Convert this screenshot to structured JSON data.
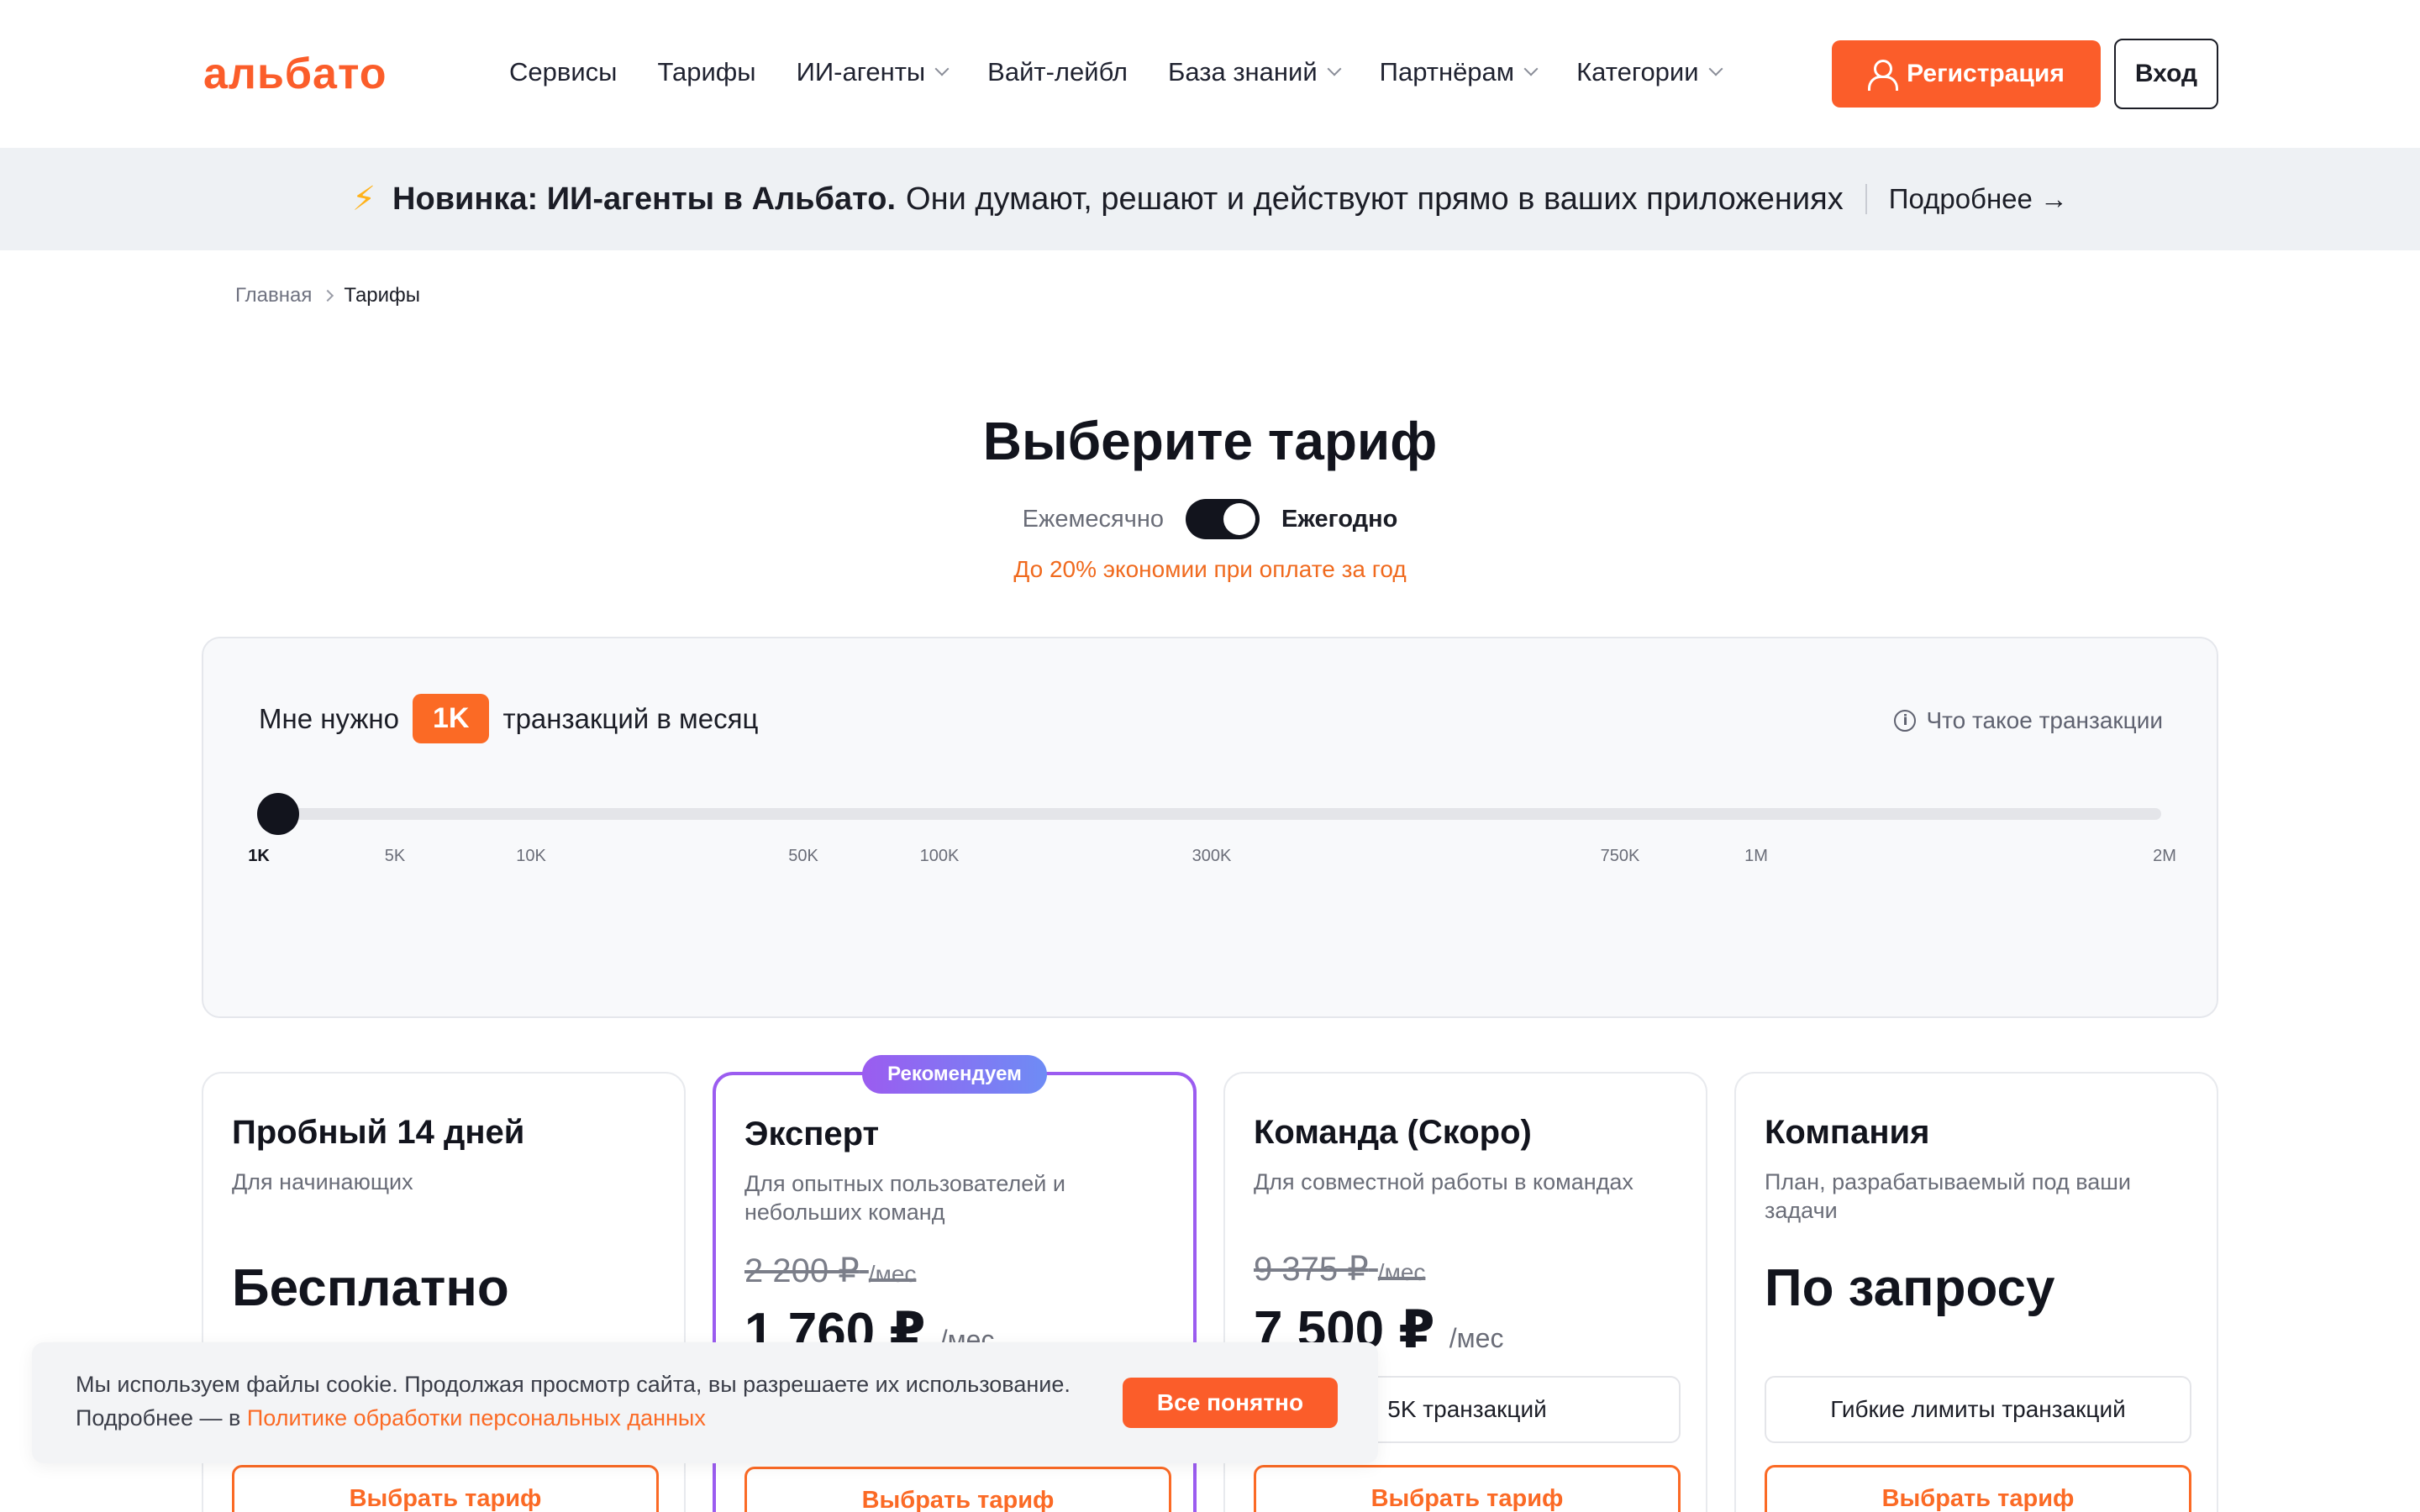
{
  "header": {
    "logo": "альбато",
    "nav": [
      {
        "label": "Сервисы",
        "dropdown": false
      },
      {
        "label": "Тарифы",
        "dropdown": false
      },
      {
        "label": "ИИ-агенты",
        "dropdown": true
      },
      {
        "label": "Вайт-лейбл",
        "dropdown": false
      },
      {
        "label": "База знаний",
        "dropdown": true
      },
      {
        "label": "Партнёрам",
        "dropdown": true
      },
      {
        "label": "Категории",
        "dropdown": true
      }
    ],
    "register_label": "Регистрация",
    "login_label": "Вход"
  },
  "banner": {
    "bold": "Новинка: ИИ-агенты в Альбато.",
    "text": "Они думают, решают и действуют прямо в ваших приложениях",
    "link": "Подробнее →"
  },
  "breadcrumb": {
    "home": "Главная",
    "current": "Тарифы"
  },
  "pricing": {
    "title": "Выберите тариф",
    "toggle_left": "Ежемесячно",
    "toggle_right": "Ежегодно",
    "toggle_on": true,
    "savings": "До 20% экономии при оплате за год"
  },
  "slider": {
    "prefix": "Мне нужно",
    "value": "1K",
    "suffix": "транзакций в месяц",
    "help": "Что такое транзакции",
    "ticks": [
      "1K",
      "5K",
      "10K",
      "50K",
      "100K",
      "300K",
      "750K",
      "1M",
      "2M"
    ]
  },
  "cards": [
    {
      "title": "Пробный 14 дней",
      "subtitle": "Для начинающих",
      "price": "Бесплатно",
      "button": "Выбрать тариф"
    },
    {
      "badge": "Рекомендуем",
      "title": "Эксперт",
      "subtitle": "Для опытных пользователей и небольших команд",
      "old_price": "2 200 ₽",
      "old_per": "/мес",
      "price": "1 760 ₽",
      "per": "/мес",
      "button": "Выбрать тариф"
    },
    {
      "title": "Команда (Скоро)",
      "subtitle": "Для совместной работы в командах",
      "old_price": "9 375 ₽",
      "old_per": "/мес",
      "price": "7 500 ₽",
      "per": "/мес",
      "pill": "5K транзакций",
      "button": "Выбрать тариф"
    },
    {
      "title": "Компания",
      "subtitle": "План, разрабатываемый под ваши задачи",
      "price": "По запросу",
      "pill": "Гибкие лимиты транзакций",
      "button": "Выбрать тариф"
    }
  ],
  "cookie": {
    "text": "Мы используем файлы cookie. Продолжая просмотр сайта, вы разрешаете их использование. Подробнее — в",
    "link": "Политике обработки персональных данных",
    "button": "Все понятно"
  },
  "colors": {
    "accent": "#fb5d2a",
    "recommended": "#9b5cf0",
    "dark": "#12141d"
  }
}
